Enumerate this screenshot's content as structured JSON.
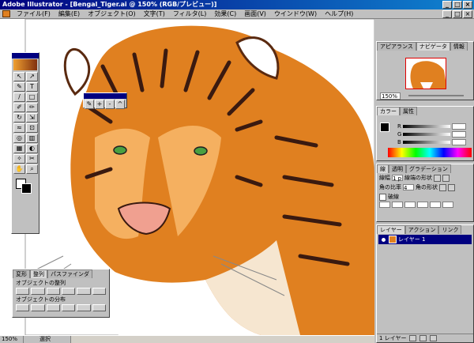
{
  "app": {
    "title": "Adobe Illustrator - [Bengal_Tiger.ai @ 150% (RGB/プレビュー)]"
  },
  "window_buttons": {
    "minimize": "_",
    "maximize": "□",
    "close": "×"
  },
  "menubar": {
    "items": [
      {
        "label": "ファイル(F)"
      },
      {
        "label": "編集(E)"
      },
      {
        "label": "オブジェクト(O)"
      },
      {
        "label": "文字(T)"
      },
      {
        "label": "フィルタ(L)"
      },
      {
        "label": "効果(C)"
      },
      {
        "label": "画面(V)"
      },
      {
        "label": "ウインドウ(W)"
      },
      {
        "label": "ヘルプ(H)"
      }
    ]
  },
  "toolbox": {
    "tools": [
      {
        "glyph": "↖",
        "icon": "selection-tool-icon"
      },
      {
        "glyph": "↗",
        "icon": "direct-selection-tool-icon"
      },
      {
        "glyph": "✎",
        "icon": "pen-tool-icon"
      },
      {
        "glyph": "T",
        "icon": "type-tool-icon"
      },
      {
        "glyph": "/",
        "icon": "line-tool-icon"
      },
      {
        "glyph": "□",
        "icon": "rectangle-tool-icon"
      },
      {
        "glyph": "✐",
        "icon": "brush-tool-icon"
      },
      {
        "glyph": "✏",
        "icon": "pencil-tool-icon"
      },
      {
        "glyph": "↻",
        "icon": "rotate-tool-icon"
      },
      {
        "glyph": "⇲",
        "icon": "scale-tool-icon"
      },
      {
        "glyph": "≈",
        "icon": "warp-tool-icon"
      },
      {
        "glyph": "⊡",
        "icon": "free-transform-tool-icon"
      },
      {
        "glyph": "◎",
        "icon": "symbol-tool-icon"
      },
      {
        "glyph": "▥",
        "icon": "graph-tool-icon"
      },
      {
        "glyph": "▦",
        "icon": "mesh-tool-icon"
      },
      {
        "glyph": "◐",
        "icon": "gradient-tool-icon"
      },
      {
        "glyph": "✧",
        "icon": "eyedropper-tool-icon"
      },
      {
        "glyph": "✂",
        "icon": "scissors-tool-icon"
      },
      {
        "glyph": "✋",
        "icon": "hand-tool-icon"
      },
      {
        "glyph": "⌕",
        "icon": "zoom-tool-icon"
      }
    ]
  },
  "subtool": {
    "tools": [
      {
        "glyph": "✎",
        "icon": "pen-icon"
      },
      {
        "glyph": "+",
        "icon": "add-anchor-icon"
      },
      {
        "glyph": "-",
        "icon": "delete-anchor-icon"
      },
      {
        "glyph": "^",
        "icon": "convert-anchor-icon"
      }
    ]
  },
  "align_palette": {
    "tabs": [
      {
        "label": "変形"
      },
      {
        "label": "整列"
      },
      {
        "label": "パスファインダ"
      }
    ],
    "align_objects": "オブジェクトの整列",
    "distribute_objects": "オブジェクトの分布"
  },
  "navigator_palette": {
    "tabs": [
      {
        "label": "アピアランス"
      },
      {
        "label": "ナビゲータ"
      },
      {
        "label": "情報"
      }
    ],
    "zoom": "150%"
  },
  "color_palette": {
    "tabs": [
      {
        "label": "カラー"
      },
      {
        "label": "属性"
      }
    ],
    "channels": [
      {
        "label": "R"
      },
      {
        "label": "G"
      },
      {
        "label": "B"
      }
    ]
  },
  "stroke_palette": {
    "tabs": [
      {
        "label": "線"
      },
      {
        "label": "透明"
      },
      {
        "label": "グラデーション"
      }
    ],
    "weight_label": "線幅",
    "weight_value": "1 p",
    "cap_label": "線端の形状",
    "miter_label": "角の比率",
    "miter_value": "4",
    "join_label": "角の形状",
    "dashed_label": "破線"
  },
  "layers_palette": {
    "tabs": [
      {
        "label": "レイヤー"
      },
      {
        "label": "アクション"
      },
      {
        "label": "リンク"
      }
    ],
    "layer_name": "レイヤー 1",
    "footer": "1 レイヤー"
  },
  "statusbar": {
    "zoom": "150%",
    "tool": "選択"
  },
  "colors": {
    "title_start": "#000080",
    "title_end": "#1084d0",
    "chrome": "#c0c0c0",
    "tiger_orange": "#e08020"
  }
}
